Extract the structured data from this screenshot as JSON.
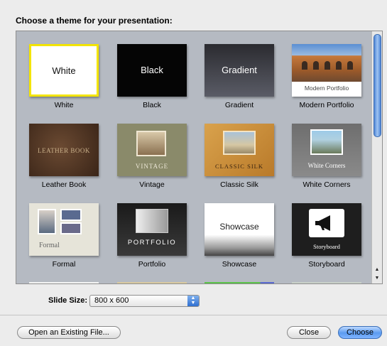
{
  "heading": "Choose a theme for your presentation:",
  "themes": [
    {
      "name": "White",
      "thumb_text": "White",
      "selected": true
    },
    {
      "name": "Black",
      "thumb_text": "Black"
    },
    {
      "name": "Gradient",
      "thumb_text": "Gradient"
    },
    {
      "name": "Modern Portfolio",
      "thumb_text": "Modern Portfolio"
    },
    {
      "name": "Leather Book",
      "thumb_text": "LEATHER BOOK"
    },
    {
      "name": "Vintage",
      "thumb_text": "VINTAGE"
    },
    {
      "name": "Classic Silk",
      "thumb_text": "CLASSIC SILK"
    },
    {
      "name": "White Corners",
      "thumb_text": "White Corners"
    },
    {
      "name": "Formal",
      "thumb_text": "Formal"
    },
    {
      "name": "Portfolio",
      "thumb_text": "PORTFOLIO"
    },
    {
      "name": "Showcase",
      "thumb_text": "Showcase"
    },
    {
      "name": "Storyboard",
      "thumb_text": "Storyboard"
    }
  ],
  "slide_size": {
    "label": "Slide Size:",
    "value": "800 x 600"
  },
  "buttons": {
    "open": "Open an Existing File...",
    "close": "Close",
    "choose": "Choose"
  },
  "colors": {
    "selection": "#f3e400",
    "panel": "#b5bac2",
    "scroll_thumb": "#4f86d6"
  }
}
